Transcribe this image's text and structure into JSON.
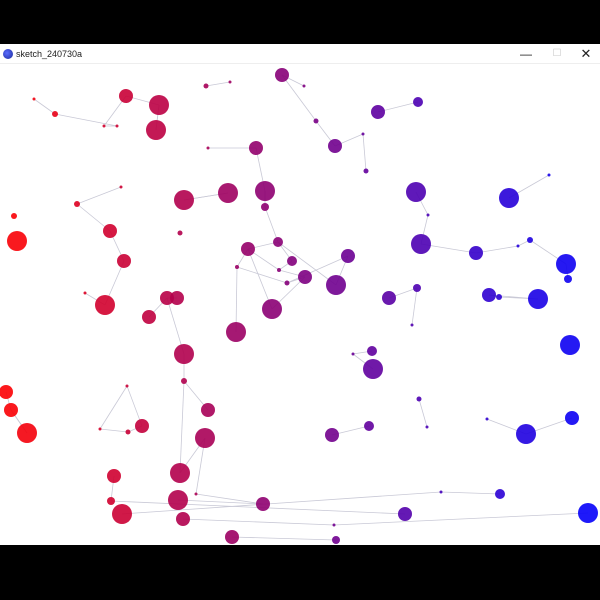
{
  "window": {
    "title": "sketch_240730a",
    "controls": {
      "minimize": "—",
      "maximize": "☐",
      "close": "✕"
    },
    "icon": "processing-app-icon"
  },
  "sketch": {
    "background": "#ffffff",
    "edge_color": "#c9c9d6",
    "color_left": "#ff0000",
    "color_right": "#0000ff",
    "node_fill": "by x position, red (left) to blue (right)",
    "nodes": [
      [
        282,
        75,
        7
      ],
      [
        206,
        86,
        2.5
      ],
      [
        230,
        82,
        1.5
      ],
      [
        304,
        86,
        1.5
      ],
      [
        126,
        96,
        7
      ],
      [
        34,
        99,
        1.5
      ],
      [
        55,
        114,
        3
      ],
      [
        159,
        105,
        10
      ],
      [
        104,
        126,
        1.5
      ],
      [
        117,
        126,
        1.5
      ],
      [
        156,
        130,
        10
      ],
      [
        378,
        112,
        7
      ],
      [
        418,
        102,
        5
      ],
      [
        316,
        121,
        2.5
      ],
      [
        335,
        146,
        7
      ],
      [
        363,
        134,
        1.5
      ],
      [
        208,
        148,
        1.5
      ],
      [
        256,
        148,
        7
      ],
      [
        366,
        171,
        2.5
      ],
      [
        549,
        175,
        1.5
      ],
      [
        121,
        187,
        1.5
      ],
      [
        77,
        204,
        3
      ],
      [
        228,
        193,
        10
      ],
      [
        265,
        191,
        10
      ],
      [
        184,
        200,
        10
      ],
      [
        416,
        192,
        10
      ],
      [
        509,
        198,
        10
      ],
      [
        265,
        207,
        4
      ],
      [
        428,
        215,
        1.5
      ],
      [
        14,
        216,
        3
      ],
      [
        110,
        231,
        7
      ],
      [
        180,
        233,
        2.5
      ],
      [
        17,
        241,
        10
      ],
      [
        421,
        244,
        10
      ],
      [
        530,
        240,
        3
      ],
      [
        278,
        242,
        5
      ],
      [
        248,
        249,
        7
      ],
      [
        476,
        253,
        7
      ],
      [
        518,
        246,
        1.5
      ],
      [
        348,
        256,
        7
      ],
      [
        124,
        261,
        7
      ],
      [
        292,
        261,
        5
      ],
      [
        566,
        264,
        10
      ],
      [
        237,
        267,
        2
      ],
      [
        279,
        270,
        2
      ],
      [
        305,
        277,
        7
      ],
      [
        568,
        279,
        4
      ],
      [
        287,
        283,
        2.5
      ],
      [
        336,
        285,
        10
      ],
      [
        417,
        288,
        4
      ],
      [
        85,
        293,
        1.5
      ],
      [
        167,
        298,
        7
      ],
      [
        177,
        298,
        7
      ],
      [
        489,
        295,
        7
      ],
      [
        499,
        297,
        3
      ],
      [
        389,
        298,
        7
      ],
      [
        538,
        299,
        10
      ],
      [
        105,
        305,
        10
      ],
      [
        272,
        309,
        10
      ],
      [
        149,
        317,
        7
      ],
      [
        236,
        332,
        10
      ],
      [
        412,
        325,
        1.5
      ],
      [
        570,
        345,
        10
      ],
      [
        372,
        351,
        5
      ],
      [
        353,
        354,
        1.5
      ],
      [
        184,
        354,
        10
      ],
      [
        373,
        369,
        10
      ],
      [
        184,
        381,
        3
      ],
      [
        127,
        386,
        1.5
      ],
      [
        6,
        392,
        7
      ],
      [
        419,
        399,
        2.5
      ],
      [
        11,
        410,
        7
      ],
      [
        208,
        410,
        7
      ],
      [
        572,
        418,
        7
      ],
      [
        487,
        419,
        1.5
      ],
      [
        142,
        426,
        7
      ],
      [
        100,
        429,
        1.5
      ],
      [
        128,
        432,
        2.5
      ],
      [
        369,
        426,
        5
      ],
      [
        427,
        427,
        1.5
      ],
      [
        27,
        433,
        10
      ],
      [
        205,
        438,
        10
      ],
      [
        526,
        434,
        10
      ],
      [
        332,
        435,
        7
      ],
      [
        114,
        476,
        7
      ],
      [
        180,
        473,
        10
      ],
      [
        441,
        492,
        1.5
      ],
      [
        500,
        494,
        5
      ],
      [
        196,
        494,
        1.5
      ],
      [
        111,
        501,
        4
      ],
      [
        178,
        500,
        10
      ],
      [
        263,
        504,
        7
      ],
      [
        122,
        514,
        10
      ],
      [
        405,
        514,
        7
      ],
      [
        588,
        513,
        10
      ],
      [
        183,
        519,
        7
      ],
      [
        334,
        525,
        1.5
      ],
      [
        232,
        537,
        7
      ],
      [
        336,
        540,
        4
      ]
    ],
    "edges": [
      [
        0,
        3
      ],
      [
        1,
        2
      ],
      [
        5,
        6
      ],
      [
        6,
        9
      ],
      [
        4,
        8
      ],
      [
        8,
        9
      ],
      [
        4,
        7
      ],
      [
        10,
        7
      ],
      [
        12,
        11
      ],
      [
        13,
        14
      ],
      [
        14,
        15
      ],
      [
        15,
        18
      ],
      [
        16,
        17
      ],
      [
        17,
        23
      ],
      [
        20,
        21
      ],
      [
        21,
        30
      ],
      [
        23,
        27
      ],
      [
        27,
        35
      ],
      [
        22,
        24
      ],
      [
        25,
        28
      ],
      [
        28,
        33
      ],
      [
        26,
        19
      ],
      [
        33,
        37
      ],
      [
        37,
        38
      ],
      [
        38,
        34
      ],
      [
        34,
        42
      ],
      [
        42,
        46
      ],
      [
        36,
        35
      ],
      [
        35,
        41
      ],
      [
        41,
        44
      ],
      [
        44,
        45
      ],
      [
        45,
        47
      ],
      [
        47,
        43
      ],
      [
        43,
        36
      ],
      [
        35,
        48
      ],
      [
        48,
        39
      ],
      [
        39,
        47
      ],
      [
        36,
        44
      ],
      [
        40,
        30
      ],
      [
        50,
        57
      ],
      [
        51,
        52
      ],
      [
        49,
        55
      ],
      [
        53,
        56
      ],
      [
        53,
        54
      ],
      [
        54,
        56
      ],
      [
        61,
        49
      ],
      [
        63,
        64
      ],
      [
        64,
        66
      ],
      [
        69,
        71
      ],
      [
        71,
        80
      ],
      [
        68,
        75
      ],
      [
        75,
        77
      ],
      [
        76,
        77
      ],
      [
        76,
        68
      ],
      [
        74,
        82
      ],
      [
        80,
        71
      ],
      [
        79,
        70
      ],
      [
        73,
        82
      ],
      [
        84,
        89
      ],
      [
        85,
        81
      ],
      [
        81,
        88
      ],
      [
        88,
        91
      ],
      [
        94,
        96
      ],
      [
        96,
        95
      ],
      [
        85,
        67
      ],
      [
        67,
        65
      ],
      [
        65,
        51
      ],
      [
        86,
        87
      ],
      [
        92,
        86
      ],
      [
        97,
        98
      ],
      [
        78,
        83
      ],
      [
        58,
        36
      ],
      [
        58,
        45
      ],
      [
        59,
        51
      ],
      [
        60,
        43
      ],
      [
        10,
        7
      ],
      [
        24,
        22
      ],
      [
        27,
        23
      ],
      [
        72,
        67
      ],
      [
        90,
        91
      ],
      [
        0,
        13
      ],
      [
        57,
        40
      ],
      [
        89,
        93
      ]
    ]
  }
}
